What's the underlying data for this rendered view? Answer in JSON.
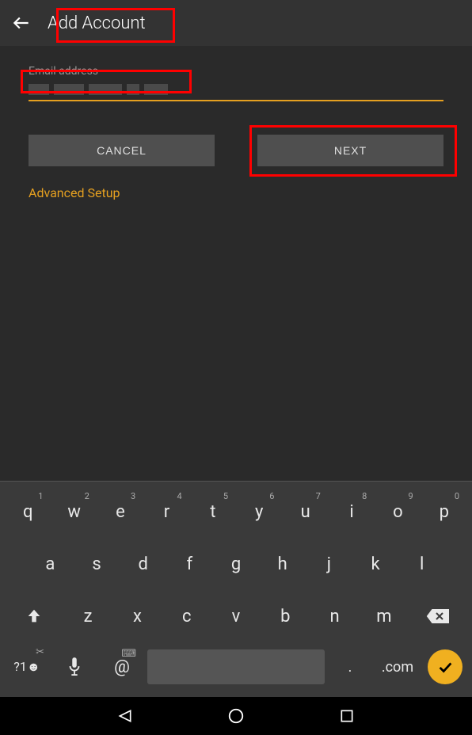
{
  "header": {
    "title": "Add Account"
  },
  "form": {
    "email_label": "Email address",
    "email_value": "",
    "cancel_label": "CANCEL",
    "next_label": "NEXT",
    "advanced_label": "Advanced Setup"
  },
  "keyboard": {
    "row1": [
      {
        "main": "q",
        "sup": "1"
      },
      {
        "main": "w",
        "sup": "2"
      },
      {
        "main": "e",
        "sup": "3"
      },
      {
        "main": "r",
        "sup": "4"
      },
      {
        "main": "t",
        "sup": "5"
      },
      {
        "main": "y",
        "sup": "6"
      },
      {
        "main": "u",
        "sup": "7"
      },
      {
        "main": "i",
        "sup": "8"
      },
      {
        "main": "o",
        "sup": "9"
      },
      {
        "main": "p",
        "sup": "0"
      }
    ],
    "row2": [
      "a",
      "s",
      "d",
      "f",
      "g",
      "h",
      "j",
      "k",
      "l"
    ],
    "row3": [
      "z",
      "x",
      "c",
      "v",
      "b",
      "n",
      "m"
    ],
    "sym_label": "?1☻",
    "sym_sup": "✂",
    "at_label": "@",
    "at_sup": "⌨",
    "dot_label": ".",
    "com_label": ".com"
  },
  "colors": {
    "accent": "#e5a020",
    "bg": "#2a2a2a",
    "key_bg": "#3a3a3a",
    "enter": "#f0b020",
    "highlight": "#ff0000"
  }
}
